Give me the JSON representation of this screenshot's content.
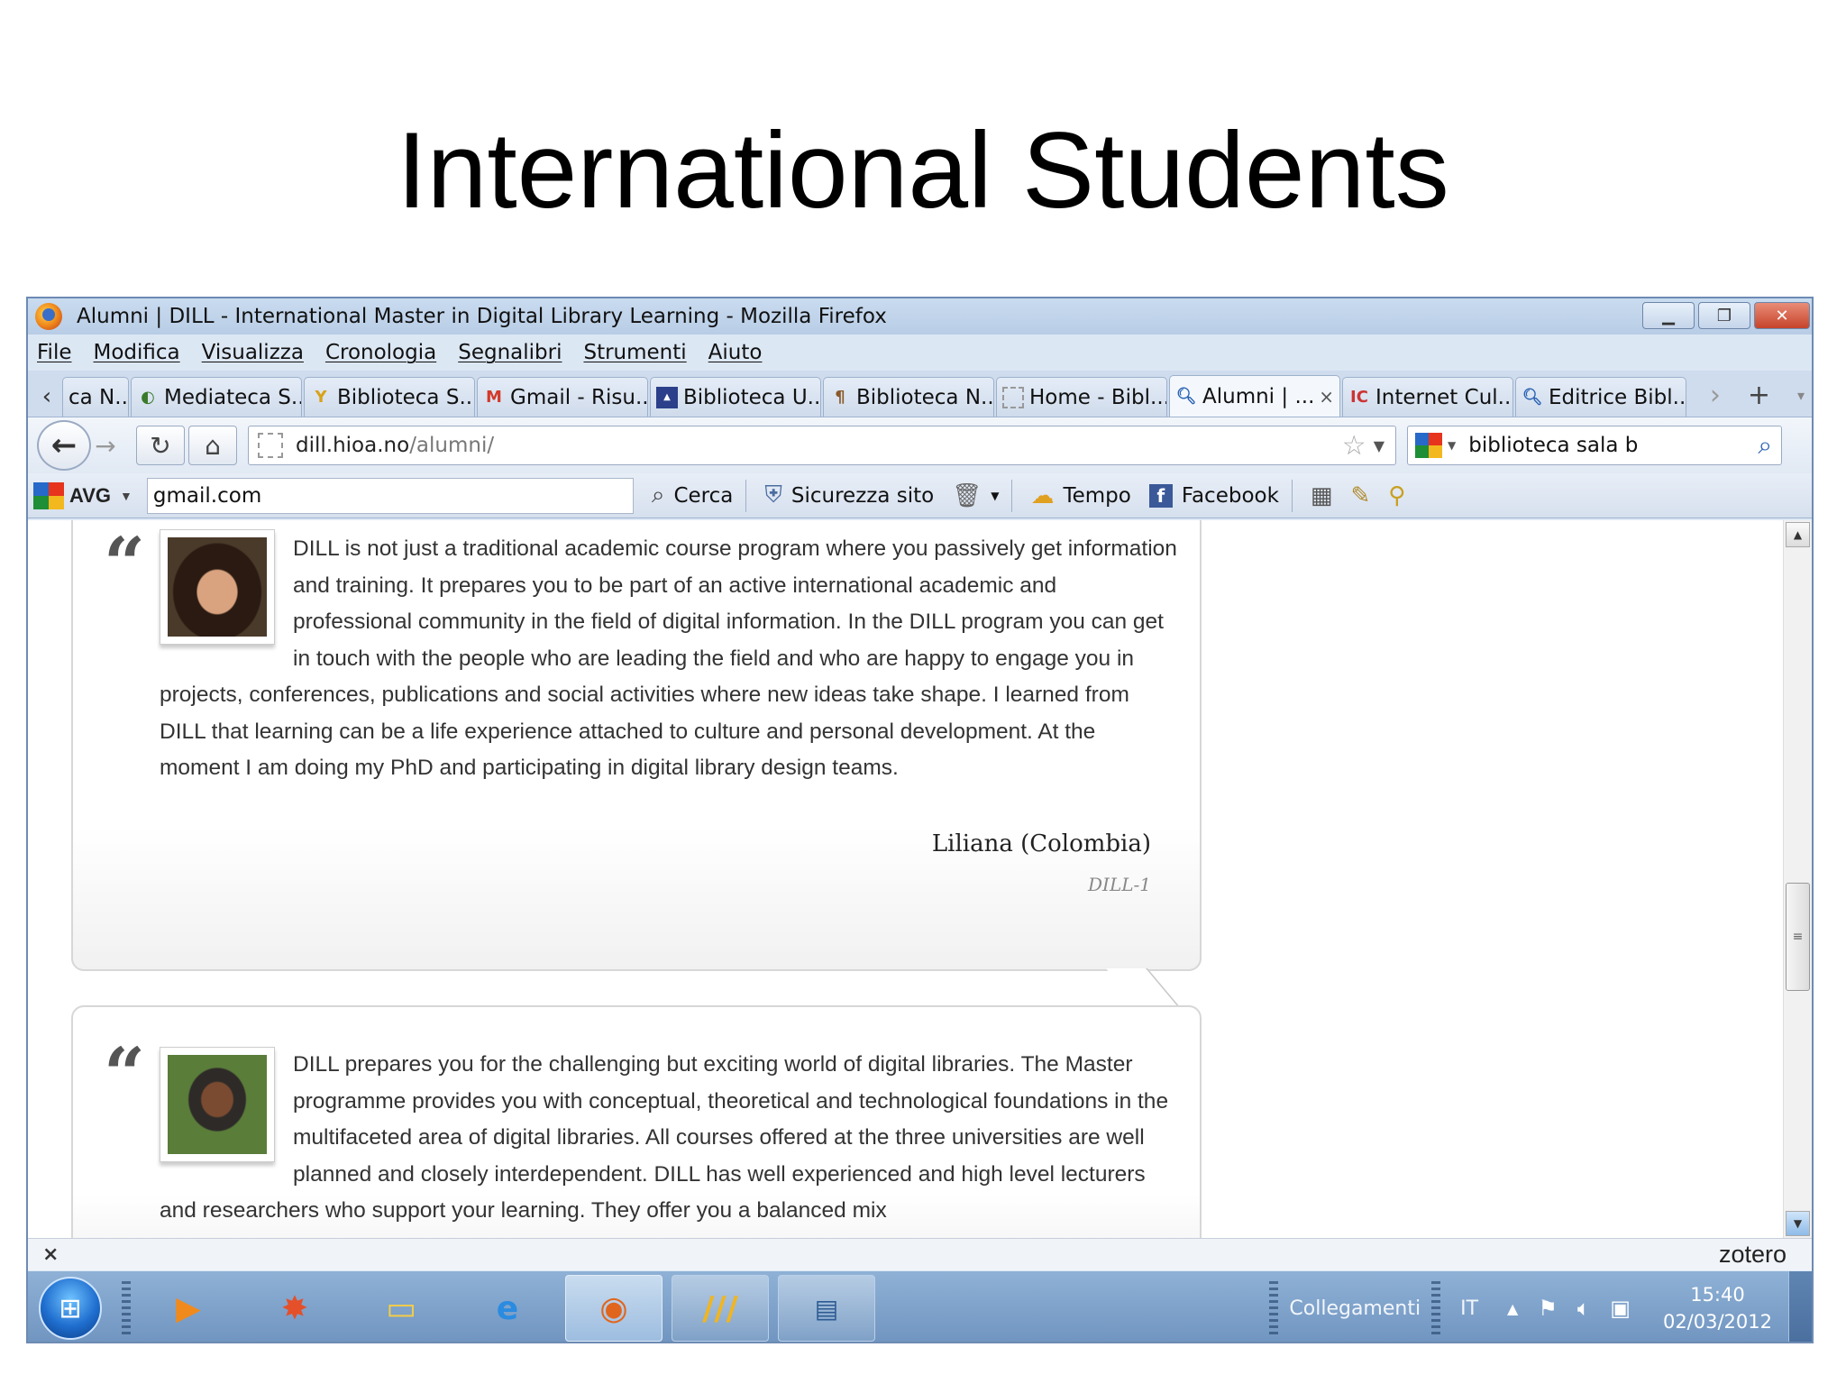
{
  "slide": {
    "title": "International Students"
  },
  "window": {
    "title": "Alumni | DILL - International Master in Digital Library Learning - Mozilla Firefox"
  },
  "menu": [
    "File",
    "Modifica",
    "Visualizza",
    "Cronologia",
    "Segnalibri",
    "Strumenti",
    "Aiuto"
  ],
  "tabs": [
    {
      "label": "ca N...",
      "icon": "page-icon"
    },
    {
      "label": "Mediateca S...",
      "icon": "mediateca-icon"
    },
    {
      "label": "Biblioteca S...",
      "icon": "biblioteca-icon"
    },
    {
      "label": "Gmail - Risu...",
      "icon": "gmail-icon"
    },
    {
      "label": "Biblioteca U...",
      "icon": "liuc-icon"
    },
    {
      "label": "Biblioteca N...",
      "icon": "library-icon"
    },
    {
      "label": "Home - Bibl...",
      "icon": "page-icon"
    },
    {
      "label": "Alumni | ...",
      "icon": "search-icon",
      "active": true
    },
    {
      "label": "Internet Cul...",
      "icon": "internet-culturale-icon"
    },
    {
      "label": "Editrice Bibl...",
      "icon": "search-icon"
    }
  ],
  "nav": {
    "url_host": "dill.hioa.no",
    "url_path": "/alumni/",
    "search_value": "biblioteca sala b"
  },
  "avg": {
    "logo": "AVG",
    "input_value": "gmail.com",
    "items": [
      {
        "label": "Cerca",
        "icon": "search-icon"
      },
      {
        "label": "Sicurezza sito",
        "icon": "shield-icon"
      },
      {
        "label": "Tempo",
        "icon": "weather-icon"
      },
      {
        "label": "Facebook",
        "icon": "facebook-icon"
      }
    ]
  },
  "testimonials": [
    {
      "text": "DILL is not just a traditional academic course program where you passively get information and training. It prepares you to be part of an active international academic and professional community in the field of digital information. In the DILL program you can get in touch with the people who are leading the field and who are happy to engage you in projects, conferences, publications and social activities where new ideas take shape. I learned from DILL that learning can be a life experience attached to culture and personal development. At the moment I am doing my PhD and participating in digital library design teams.",
      "author": "Liliana (Colombia)",
      "cohort": "DILL-1"
    },
    {
      "text": "DILL prepares you for the challenging but exciting world of digital libraries. The Master programme provides you with conceptual, theoretical and technological foundations in the multifaceted area of digital libraries. All courses offered at the three universities are well planned and closely interdependent. DILL has well experienced and high level lecturers and researchers who support your learning. They offer you a balanced mix"
    }
  ],
  "addon_bar": {
    "brand": "zotero"
  },
  "taskbar": {
    "links_label": "Collegamenti",
    "lang": "IT",
    "time": "15:40",
    "date": "02/03/2012"
  }
}
